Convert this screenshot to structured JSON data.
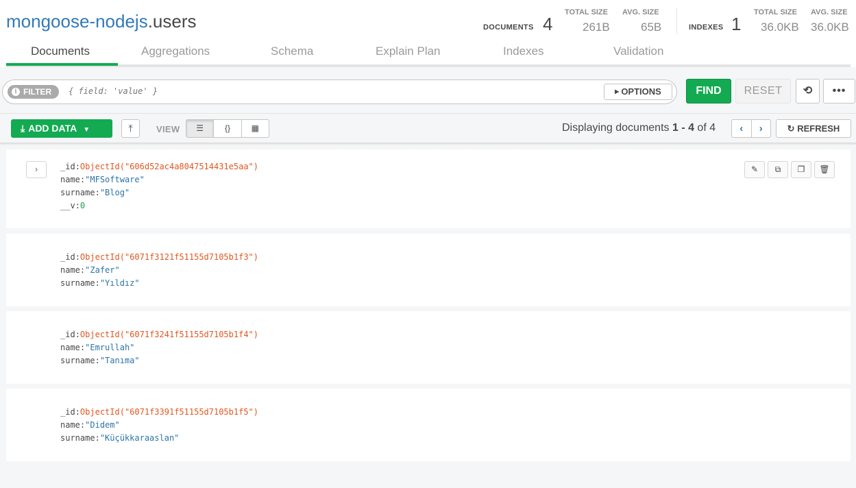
{
  "header": {
    "db_name": "mongoose-nodejs",
    "collection_name": ".users",
    "documents_label": "DOCUMENTS",
    "documents_count": "4",
    "total_size_label": "TOTAL SIZE",
    "total_size_value": "261B",
    "avg_size_label": "AVG. SIZE",
    "avg_size_value": "65B",
    "indexes_label": "INDEXES",
    "indexes_count": "1",
    "idx_total_size_label": "TOTAL SIZE",
    "idx_total_size_value": "36.0KB",
    "idx_avg_size_label": "AVG. SIZE",
    "idx_avg_size_value": "36.0KB"
  },
  "tabs": [
    {
      "label": "Documents",
      "active": true
    },
    {
      "label": "Aggregations"
    },
    {
      "label": "Schema"
    },
    {
      "label": "Explain Plan"
    },
    {
      "label": "Indexes"
    },
    {
      "label": "Validation"
    }
  ],
  "querybar": {
    "filter_label": "FILTER",
    "filter_placeholder": "{ field: 'value' }",
    "options_label": "OPTIONS",
    "find_label": "FIND",
    "reset_label": "RESET",
    "more_label": "•••"
  },
  "controls": {
    "add_data_label": "ADD DATA",
    "view_label": "VIEW",
    "displaying_prefix": "Displaying documents ",
    "displaying_range": "1 - 4",
    "displaying_of": " of ",
    "displaying_total": "4",
    "refresh_label": "REFRESH"
  },
  "documents": [
    {
      "id_key": "_id",
      "id_value": "ObjectId(\"606d52ac4a8047514431e5aa\")",
      "name_key": "name",
      "name_value": "\"MFSoftware\"",
      "surname_key": "surname",
      "surname_value": "\"Blog\"",
      "v_key": "__v",
      "v_value": "0"
    },
    {
      "id_key": "_id",
      "id_value": "ObjectId(\"6071f3121f51155d7105b1f3\")",
      "name_key": "name",
      "name_value": "\"Zafer\"",
      "surname_key": "surname",
      "surname_value": "\"Yıldız\""
    },
    {
      "id_key": "_id",
      "id_value": "ObjectId(\"6071f3241f51155d7105b1f4\")",
      "name_key": "name",
      "name_value": "\"Emrullah\"",
      "surname_key": "surname",
      "surname_value": "\"Tanıma\""
    },
    {
      "id_key": "_id",
      "id_value": "ObjectId(\"6071f3391f51155d7105b1f5\")",
      "name_key": "name",
      "name_value": "\"Didem\"",
      "surname_key": "surname",
      "surname_value": "\"Küçükkaraaslan\""
    }
  ],
  "colors": {
    "accent_green": "#13aa52",
    "link_blue": "#337ab7",
    "objectid_orange": "#e2561e",
    "string_blue": "#2c74a9"
  }
}
